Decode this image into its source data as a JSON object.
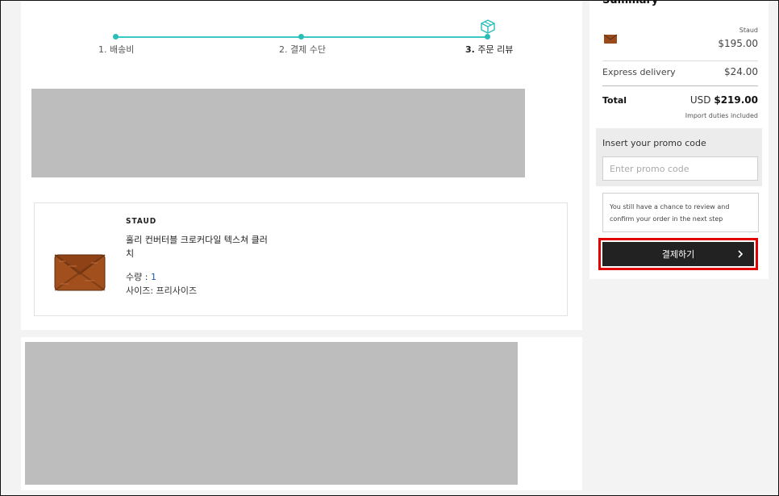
{
  "stepper": {
    "steps": [
      {
        "num": "1.",
        "label": "배송비"
      },
      {
        "num": "2.",
        "label": "결제 수단"
      },
      {
        "num": "3.",
        "label": "주문 리뷰"
      }
    ]
  },
  "product": {
    "brand": "STAUD",
    "name": "홀리 컨버터블 크로커다일 텍스쳐 클러치",
    "qty_label": "수량 : ",
    "qty_value": "1",
    "size_label": "사이즈: 프리사이즈"
  },
  "summary": {
    "title": "Summary",
    "item_brand": "Staud",
    "item_price": "$195.00",
    "delivery_label": "Express delivery",
    "delivery_price": "$24.00",
    "total_label": "Total",
    "total_currency": "USD",
    "total_amount": "$219.00",
    "duties_note": "Import duties included",
    "promo_label": "Insert your promo code",
    "promo_placeholder": "Enter promo code",
    "notice": "You still have a chance to review and confirm your order in the next step",
    "checkout_label": "결제하기"
  },
  "colors": {
    "accent": "#2bbdb8",
    "highlight": "#e00000",
    "button": "#222222"
  },
  "icons": [
    "box-icon",
    "chevron-right-icon"
  ]
}
